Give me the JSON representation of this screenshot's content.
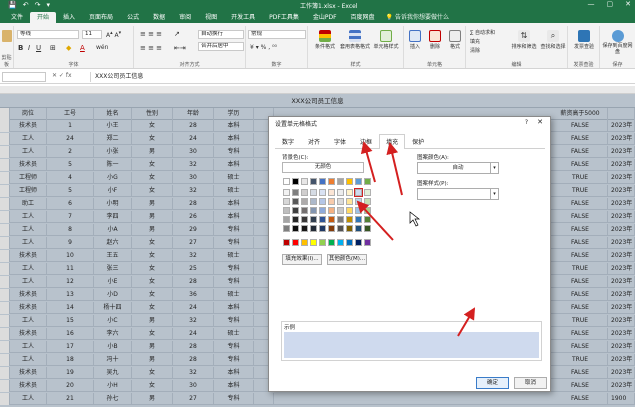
{
  "app": {
    "title": "工作簿1.xlsx - Excel",
    "quick_access": [
      "💾",
      "↶",
      "↷",
      "▾"
    ],
    "window_buttons": [
      "—",
      "▢",
      "✕"
    ],
    "tell_me": "告诉我你想要做什么"
  },
  "ribbon": {
    "tabs": [
      "文件",
      "插入",
      "页面布局",
      "公式",
      "数据",
      "审阅",
      "视图",
      "开发工具",
      "PDF工具集",
      "金山PDF",
      "百度网盘"
    ],
    "active_tab": "开始",
    "font_name": "等线",
    "font_size": "11",
    "number_format": "常规",
    "groups": {
      "clipboard": "剪贴板",
      "font": "字体",
      "alignment": "对齐方式",
      "number": "数字",
      "styles": "样式",
      "cells": "单元格",
      "editing": "编辑",
      "invoice": "发票查验",
      "save": "保存"
    },
    "buttons": {
      "wrap_text": "自动换行",
      "merge_center": "合并后居中",
      "cond_format": "条件格式",
      "table_format": "套用表格格式",
      "cell_styles": "单元格样式",
      "insert": "插入",
      "delete": "删除",
      "format": "格式",
      "autosum": "∑ 自动求和",
      "fill": "填充",
      "clear": "清除",
      "sort_filter": "排序和筛选",
      "find_select": "查找和选择",
      "invoice_check": "发票查验",
      "save_baidu": "保存到百度网盘"
    }
  },
  "formula_bar": {
    "name_box": "",
    "icons": "✕ ✓ fx",
    "content": "XXX公司员工信息"
  },
  "sheet": {
    "title": "XXX公司员工信息",
    "headers": [
      "岗位",
      "工号",
      "姓名",
      "性别",
      "年龄",
      "学历",
      "",
      "薪资高于5000",
      ""
    ],
    "rows": [
      [
        "技术员",
        "1",
        "小王",
        "女",
        "28",
        "本科",
        "",
        "FALSE",
        "2023年"
      ],
      [
        "工人",
        "24",
        "郑二",
        "女",
        "24",
        "本科",
        "",
        "FALSE",
        "2023年"
      ],
      [
        "工人",
        "2",
        "小张",
        "男",
        "30",
        "专科",
        "",
        "FALSE",
        "2023年"
      ],
      [
        "技术员",
        "5",
        "陈一",
        "女",
        "32",
        "本科",
        "",
        "FALSE",
        "2023年"
      ],
      [
        "工程师",
        "4",
        "小G",
        "女",
        "30",
        "硕士",
        "",
        "TRUE",
        "2023年"
      ],
      [
        "工程师",
        "5",
        "小F",
        "女",
        "32",
        "硕士",
        "",
        "TRUE",
        "2023年"
      ],
      [
        "助工",
        "6",
        "小明",
        "男",
        "28",
        "本科",
        "",
        "FALSE",
        "2023年"
      ],
      [
        "工人",
        "7",
        "李四",
        "男",
        "26",
        "本科",
        "",
        "FALSE",
        "2023年"
      ],
      [
        "工人",
        "8",
        "小A",
        "男",
        "29",
        "专科",
        "",
        "FALSE",
        "2023年"
      ],
      [
        "工人",
        "9",
        "赵六",
        "女",
        "27",
        "专科",
        "",
        "FALSE",
        "2023年"
      ],
      [
        "技术员",
        "10",
        "王五",
        "女",
        "32",
        "硕士",
        "",
        "FALSE",
        "2023年"
      ],
      [
        "工人",
        "11",
        "张三",
        "女",
        "25",
        "专科",
        "",
        "TRUE",
        "2023年"
      ],
      [
        "工人",
        "12",
        "小E",
        "女",
        "28",
        "专科",
        "",
        "FALSE",
        "2023年"
      ],
      [
        "技术员",
        "13",
        "小D",
        "女",
        "36",
        "硕士",
        "",
        "FALSE",
        "2023年"
      ],
      [
        "技术员",
        "14",
        "杨十四",
        "女",
        "24",
        "本科",
        "",
        "FALSE",
        "2023年"
      ],
      [
        "工人",
        "15",
        "小C",
        "男",
        "32",
        "专科",
        "",
        "TRUE",
        "2023年"
      ],
      [
        "技术员",
        "16",
        "李六",
        "女",
        "24",
        "硕士",
        "",
        "FALSE",
        "2023年"
      ],
      [
        "工人",
        "17",
        "小B",
        "男",
        "28",
        "专科",
        "",
        "FALSE",
        "2023年"
      ],
      [
        "工人",
        "18",
        "冯十",
        "男",
        "28",
        "专科",
        "",
        "TRUE",
        "2023年"
      ],
      [
        "技术员",
        "19",
        "吴九",
        "女",
        "32",
        "本科",
        "",
        "FALSE",
        "2023年"
      ],
      [
        "技术员",
        "20",
        "小H",
        "女",
        "30",
        "本科",
        "",
        "FALSE",
        "2023年"
      ],
      [
        "工人",
        "21",
        "孙七",
        "男",
        "27",
        "专科",
        "",
        "FALSE",
        "1900"
      ]
    ]
  },
  "dialog": {
    "title": "设置单元格格式",
    "help": "?",
    "close": "✕",
    "tabs": [
      "数字",
      "对齐",
      "字体",
      "边框",
      "填充",
      "保护"
    ],
    "active_tab": "填充",
    "bg_color_label": "背景色(C):",
    "no_color": "无颜色",
    "fill_effects": "填充效果(I)...",
    "more_colors": "其他颜色(M)...",
    "pattern_color_label": "图案颜色(A):",
    "pattern_color_value": "自动",
    "pattern_style_label": "图案样式(P):",
    "pattern_style_value": "",
    "sample_label": "示例",
    "ok": "确定",
    "cancel": "取消",
    "selected_color": "#cfdaee",
    "theme_colors": [
      [
        "#ffffff",
        "#000000",
        "#e7e6e6",
        "#44546a",
        "#4472c4",
        "#ed7d31",
        "#a5a5a5",
        "#ffc000",
        "#5b9bd5",
        "#70ad47"
      ],
      [
        "#f2f2f2",
        "#7f7f7f",
        "#d0cece",
        "#d6dce4",
        "#d9e2f3",
        "#fbe5d5",
        "#ededed",
        "#fff2cc",
        "#cfdaee",
        "#e2efd9"
      ],
      [
        "#d8d8d8",
        "#595959",
        "#aeabab",
        "#adb9ca",
        "#b4c6e7",
        "#f7cbac",
        "#dbdbdb",
        "#fee599",
        "#bdd7ee",
        "#c5e0b3"
      ],
      [
        "#bfbfbf",
        "#3f3f3f",
        "#757070",
        "#8496b0",
        "#8eaadb",
        "#f4b183",
        "#c9c9c9",
        "#ffd965",
        "#9cc3e5",
        "#a8d08d"
      ],
      [
        "#a5a5a5",
        "#262626",
        "#3a3838",
        "#323f4f",
        "#2f5496",
        "#c55a11",
        "#7b7b7b",
        "#bf8f00",
        "#2e75b5",
        "#538135"
      ],
      [
        "#7f7f7f",
        "#0c0c0c",
        "#171616",
        "#222a35",
        "#1f3864",
        "#833c0b",
        "#525252",
        "#7f6000",
        "#1e4e79",
        "#375623"
      ]
    ],
    "standard_colors": [
      "#c00000",
      "#ff0000",
      "#ffc000",
      "#ffff00",
      "#92d050",
      "#00b050",
      "#00b0f0",
      "#0070c0",
      "#002060",
      "#7030a0"
    ]
  },
  "colors": {
    "excel_green": "#217346",
    "grid_fill": "#b8c2cc",
    "annotation_red": "#d42020"
  }
}
